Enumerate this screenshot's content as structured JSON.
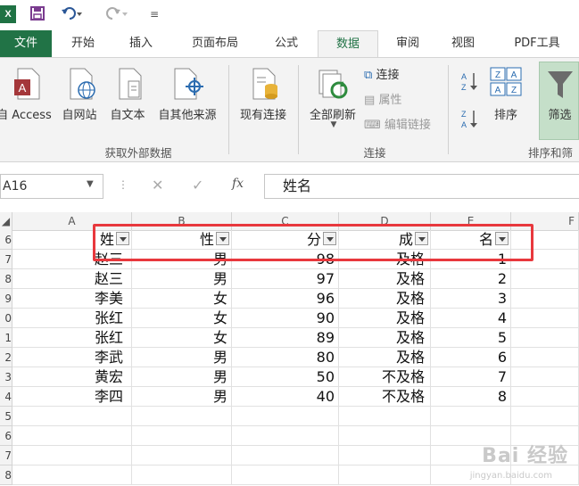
{
  "quick_access": {
    "logo": "X",
    "undo_icon": "undo-icon",
    "redo_icon": "redo-icon"
  },
  "tabs": [
    {
      "label": "文件"
    },
    {
      "label": "开始"
    },
    {
      "label": "插入"
    },
    {
      "label": "页面布局"
    },
    {
      "label": "公式"
    },
    {
      "label": "数据"
    },
    {
      "label": "审阅"
    },
    {
      "label": "视图"
    },
    {
      "label": "PDF工具"
    }
  ],
  "ribbon": {
    "external": {
      "buttons": [
        "自 Access",
        "自网站",
        "自文本",
        "自其他来源"
      ],
      "group_label": "获取外部数据"
    },
    "existing_label": "现有连接",
    "refresh_label": "全部刷新",
    "connections": {
      "connect": "连接",
      "properties": "属性",
      "edit_links": "编辑链接",
      "group_label": "连接"
    },
    "sort": {
      "sort_label": "排序",
      "filter_label": "筛选",
      "group_label": "排序和筛"
    }
  },
  "formula_bar": {
    "name_box": "A16",
    "fx": "fx",
    "content": "姓名"
  },
  "columns": [
    "A",
    "B",
    "C",
    "D",
    "E",
    "F"
  ],
  "row_numbers": [
    "6",
    "7",
    "8",
    "9",
    "0",
    "1",
    "2",
    "3",
    "4",
    "5",
    "6",
    "7",
    "8"
  ],
  "header_row": [
    "姓",
    "性",
    "分",
    "成",
    "名"
  ],
  "rows": [
    [
      "赵三",
      "男",
      "98",
      "及格",
      "1"
    ],
    [
      "赵三",
      "男",
      "97",
      "及格",
      "2"
    ],
    [
      "李美",
      "女",
      "96",
      "及格",
      "3"
    ],
    [
      "张红",
      "女",
      "90",
      "及格",
      "4"
    ],
    [
      "张红",
      "女",
      "89",
      "及格",
      "5"
    ],
    [
      "李武",
      "男",
      "80",
      "及格",
      "6"
    ],
    [
      "黄宏",
      "男",
      "50",
      "不及格",
      "7"
    ],
    [
      "李四",
      "男",
      "40",
      "不及格",
      "8"
    ]
  ],
  "watermark": {
    "main": "Bai 经验",
    "sub": "jingyan.baidu.com"
  }
}
